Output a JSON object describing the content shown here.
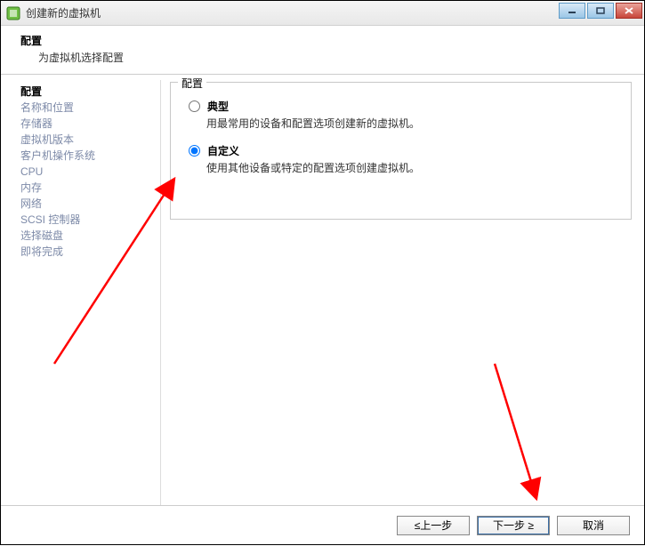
{
  "titlebar": {
    "title": "创建新的虚拟机"
  },
  "header": {
    "title": "配置",
    "subtitle": "为虚拟机选择配置"
  },
  "sidebar": {
    "steps": [
      "配置",
      "名称和位置",
      "存储器",
      "虚拟机版本",
      "客户机操作系统",
      "CPU",
      "内存",
      "网络",
      "SCSI 控制器",
      "选择磁盘",
      "即将完成"
    ],
    "activeIndex": 0
  },
  "group": {
    "legend": "配置",
    "options": {
      "typical": {
        "label": "典型",
        "desc": "用最常用的设备和配置选项创建新的虚拟机。",
        "checked": false
      },
      "custom": {
        "label": "自定义",
        "desc": "使用其他设备或特定的配置选项创建虚拟机。",
        "checked": true
      }
    }
  },
  "footer": {
    "back": "≤上一步",
    "next": "下一步 ≥",
    "cancel": "取消"
  }
}
